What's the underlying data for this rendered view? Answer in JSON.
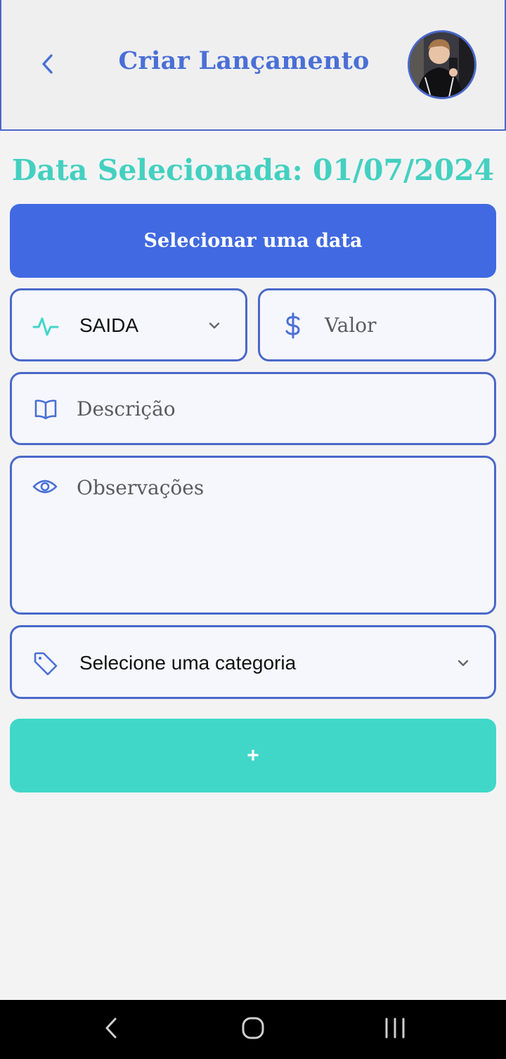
{
  "header": {
    "title": "Criar Lançamento",
    "back_icon": "chevron-left-icon",
    "avatar": "user-avatar"
  },
  "date_label": "Data Selecionada: 01/07/2024",
  "select_date_button": "Selecionar uma data",
  "type_select": {
    "value": "SAIDA",
    "icon": "activity-icon"
  },
  "value_input": {
    "placeholder": "Valor",
    "icon": "dollar-icon"
  },
  "description_input": {
    "placeholder": "Descrição",
    "icon": "book-icon"
  },
  "notes_input": {
    "placeholder": "Observações",
    "icon": "eye-icon"
  },
  "category_select": {
    "placeholder": "Selecione uma categoria",
    "icon": "tag-icon"
  },
  "add_button": "+",
  "colors": {
    "primary": "#4169e1",
    "accent": "#40d7c9",
    "border": "#4a68c9",
    "title": "#4a6fd6",
    "date_label": "#44d0c0"
  },
  "navbar": {
    "back": "nav-back-icon",
    "home": "nav-home-icon",
    "recents": "nav-recents-icon"
  }
}
